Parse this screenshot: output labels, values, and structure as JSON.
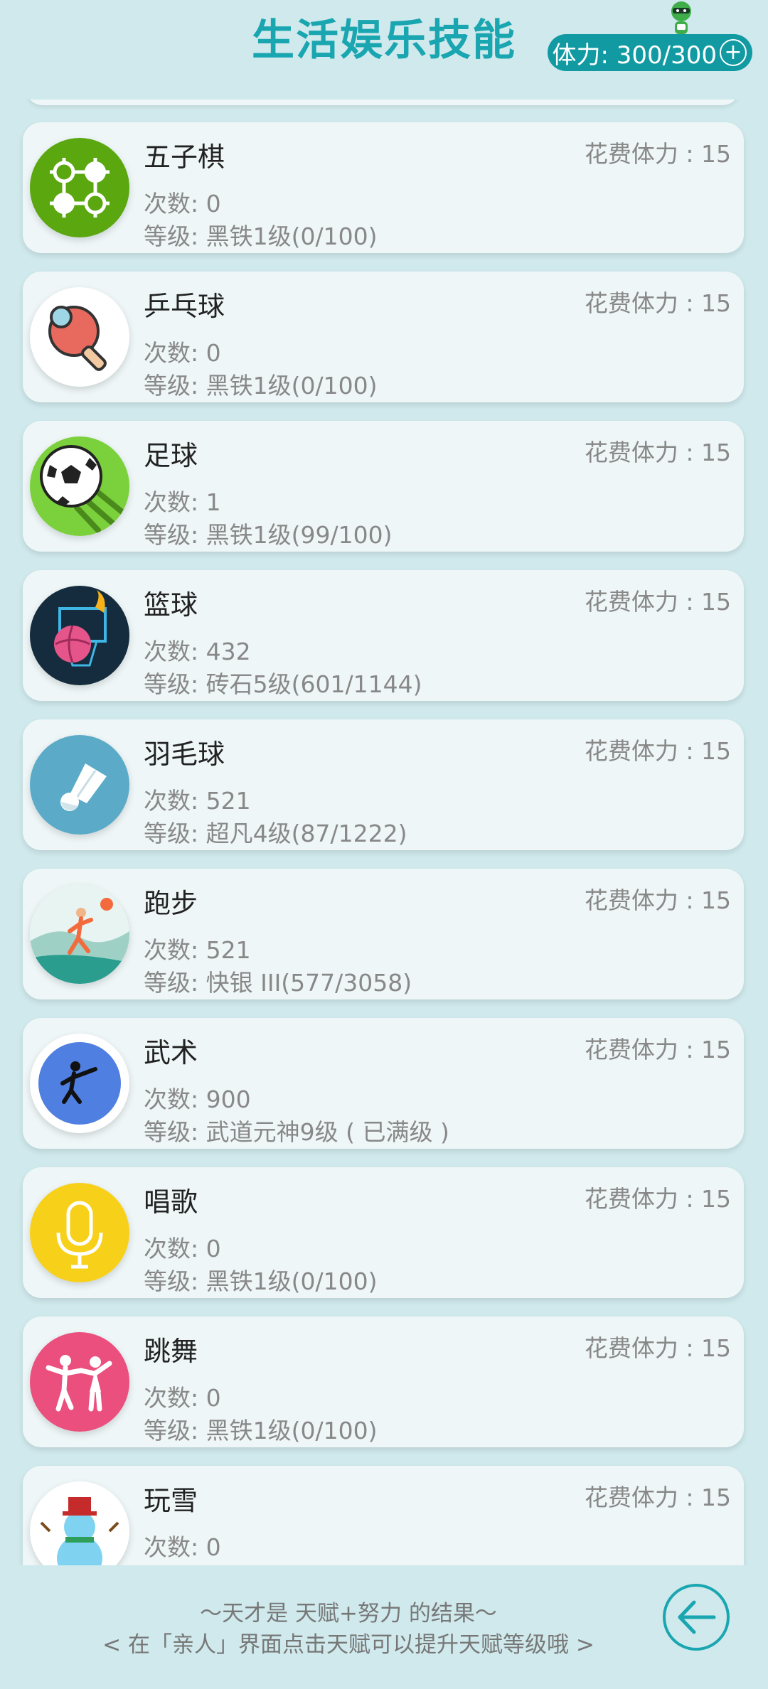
{
  "header": {
    "title": "生活娱乐技能",
    "stamina_label": "体力: 300/300",
    "plus_icon": "+"
  },
  "skills": [
    {
      "name": "五子棋",
      "cost": "花费体力 : 15",
      "count": "次数: 0",
      "level": "等级: 黑铁1级(0/100)",
      "icon": "gomoku-icon"
    },
    {
      "name": "乒乓球",
      "cost": "花费体力 : 15",
      "count": "次数: 0",
      "level": "等级: 黑铁1级(0/100)",
      "icon": "ping-pong-icon"
    },
    {
      "name": "足球",
      "cost": "花费体力 : 15",
      "count": "次数: 1",
      "level": "等级: 黑铁1级(99/100)",
      "icon": "soccer-icon"
    },
    {
      "name": "篮球",
      "cost": "花费体力 : 15",
      "count": "次数: 432",
      "level": "等级: 砖石5级(601/1144)",
      "icon": "basketball-icon"
    },
    {
      "name": "羽毛球",
      "cost": "花费体力 : 15",
      "count": "次数: 521",
      "level": "等级: 超凡4级(87/1222)",
      "icon": "badminton-icon"
    },
    {
      "name": "跑步",
      "cost": "花费体力 : 15",
      "count": "次数: 521",
      "level": "等级: 快银 III(577/3058)",
      "icon": "running-icon"
    },
    {
      "name": "武术",
      "cost": "花费体力 : 15",
      "count": "次数: 900",
      "level": "等级: 武道元神9级 ( 已满级 )",
      "icon": "martial-arts-icon"
    },
    {
      "name": "唱歌",
      "cost": "花费体力 : 15",
      "count": "次数: 0",
      "level": "等级: 黑铁1级(0/100)",
      "icon": "microphone-icon"
    },
    {
      "name": "跳舞",
      "cost": "花费体力 : 15",
      "count": "次数: 0",
      "level": "等级: 黑铁1级(0/100)",
      "icon": "dance-icon"
    },
    {
      "name": "玩雪",
      "cost": "花费体力 : 15",
      "count": "次数: 0",
      "level": "",
      "icon": "snowman-icon"
    }
  ],
  "footer": {
    "tip_line1": "〜天才是 天赋+努力 的结果〜",
    "tip_line2": "< 在「亲人」界面点击天赋可以提升天赋等级哦 >"
  },
  "colors": {
    "accent": "#1aa6b0",
    "background": "#cfe9ec",
    "card": "#eef6f7"
  }
}
